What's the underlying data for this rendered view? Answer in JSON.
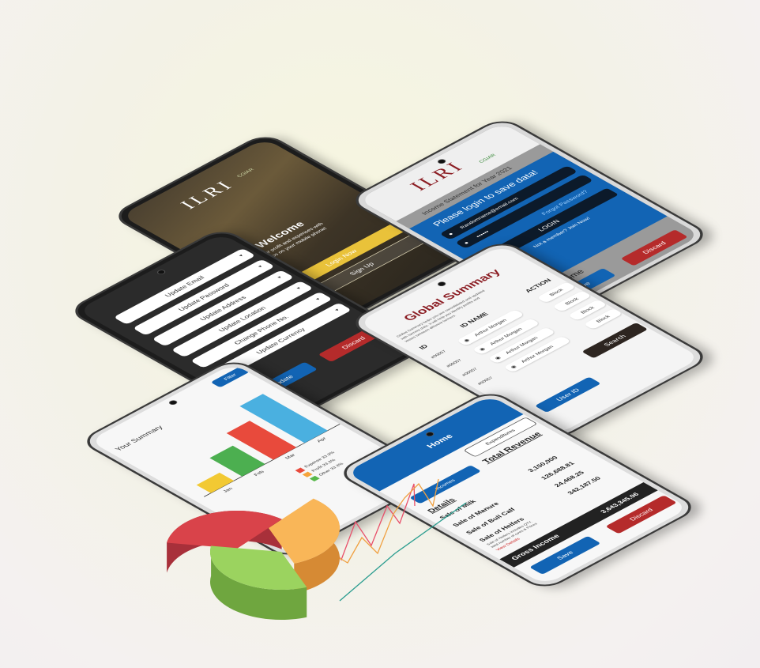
{
  "welcome": {
    "logo": "ILRI",
    "logo_sub": "CGIAR",
    "title": "Welcome",
    "subtitle_1": "Calculate your profit and expenses with",
    "subtitle_2": "few steps on your mobile phone!",
    "login_button": "Login Now",
    "signup_button": "Sign Up"
  },
  "login": {
    "logo": "ILRI",
    "logo_sub": "CGIAR",
    "statement_title": "Income Statement for Year 2021",
    "heading": "Please login to save data!",
    "email_value": "Randomname@email.com",
    "password_value": "••••••",
    "forgot": "Forgot Password?",
    "login_button": "LOGIN",
    "member_text": "Not a member? Join Now!",
    "background_label": "Net Income",
    "save_button": "Save",
    "discard_button": "Discard"
  },
  "settings": {
    "items": [
      "Update Email",
      "Update Password",
      "Update Address",
      "Update Location",
      "Change Phone No.",
      "Update Currency"
    ],
    "update_button": "Update",
    "discard_button": "Discard"
  },
  "global_summary": {
    "title": "Global Summary",
    "description_1": "Global Summary helps you see consolidated and updated",
    "description_2": "with farmers data. It will help you identify profits and",
    "description_3": "losses between different farmers.",
    "columns": [
      "ID",
      "ID NAME",
      "ACTION"
    ],
    "rows": [
      {
        "id": "#00057",
        "name": "Arthur Morgan",
        "action": "Block"
      },
      {
        "id": "#00057",
        "name": "Arthur Morgan",
        "action": "Block"
      },
      {
        "id": "#00057",
        "name": "Arthur Morgan",
        "action": "Block"
      },
      {
        "id": "#00057",
        "name": "Arthur Morgan",
        "action": "Block"
      }
    ],
    "search_button": "Search",
    "user_id_button": "User ID"
  },
  "summary_chart": {
    "filter_button": "Filter",
    "title": "Your Summary",
    "legend": [
      {
        "name": "Expense",
        "value": "33.3%",
        "color": "#e84a3c"
      },
      {
        "name": "Profit",
        "value": "33.3%",
        "color": "#f5a43c"
      },
      {
        "name": "Other",
        "value": "33.3%",
        "color": "#58b84a"
      }
    ],
    "bottom_label": "b"
  },
  "chart_data": {
    "type": "bar",
    "categories": [
      "Jan",
      "Feb",
      "Mar",
      "Apr"
    ],
    "series": [
      {
        "values": [
          20,
          45,
          65,
          90
        ]
      }
    ],
    "colors": [
      "#f2c933",
      "#4caf50",
      "#e84a3c",
      "#4ab0e0"
    ],
    "pie": {
      "type": "pie",
      "labels": [
        "Expense",
        "Profit",
        "Other"
      ],
      "values": [
        33.3,
        33.3,
        33.3
      ],
      "colors": [
        "#d9434a",
        "#f9b658",
        "#9bd35f"
      ]
    }
  },
  "home": {
    "header": "Home",
    "tab_expenditures": "Expenditures",
    "tab_incomes": "Incomes",
    "total_label": "Total Revenue",
    "details_label": "Details",
    "items": [
      {
        "name": "Sale of Milk",
        "value": "3,150,000"
      },
      {
        "name": "Sale of Manure",
        "value": "126,688.81"
      },
      {
        "name": "Sale of Bull Calf",
        "value": "24,468.25"
      },
      {
        "name": "Sale of Heifers",
        "value": "342,187.50"
      }
    ],
    "note_1": "Sale of Heifers Includes QTY.",
    "note_2": "total number of cows & Prices",
    "view_details": "View Details",
    "gross_label": "Gross Income",
    "gross_value": "3,643,345.06",
    "save_button": "Save",
    "discard_button": "Discard"
  }
}
